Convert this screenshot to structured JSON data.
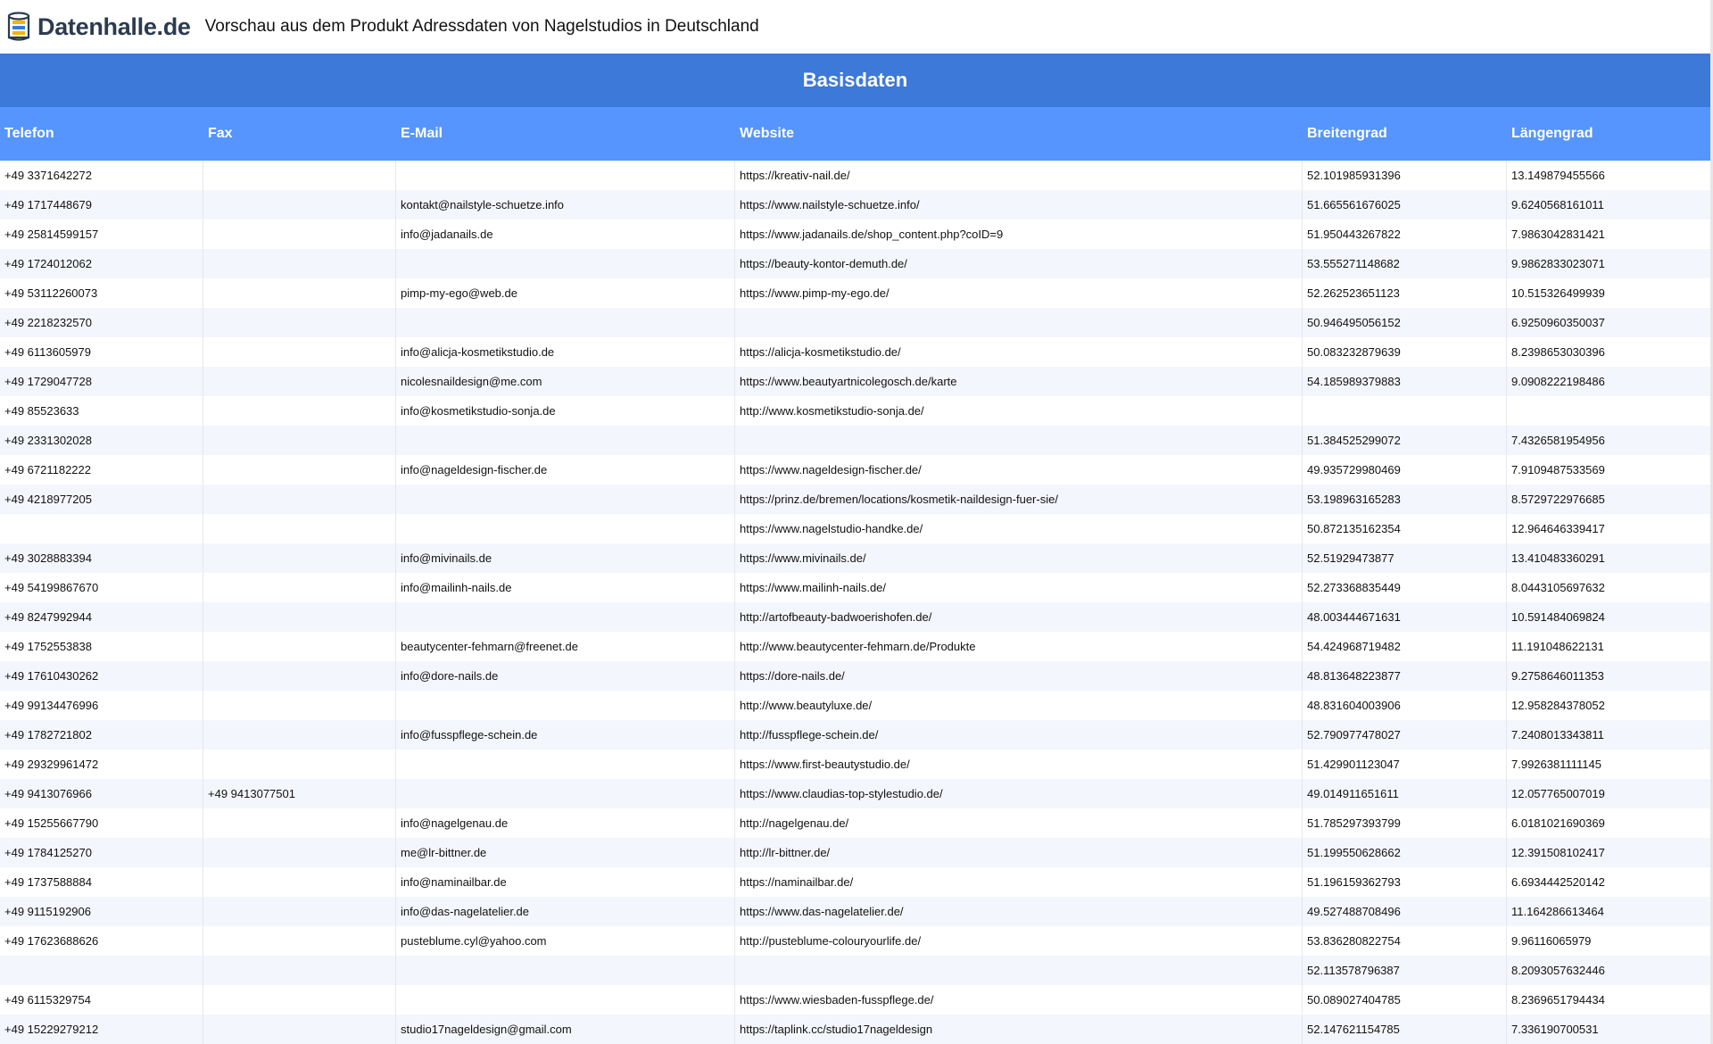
{
  "header": {
    "logo_text": "Datenhalle.de",
    "title": "Vorschau aus dem Produkt Adressdaten von Nagelstudios in Deutschland"
  },
  "section": {
    "title": "Basisdaten"
  },
  "columns": [
    "Telefon",
    "Fax",
    "E-Mail",
    "Website",
    "Breitengrad",
    "Längengrad"
  ],
  "rows": [
    [
      "+49 3371642272",
      "",
      "",
      "https://kreativ-nail.de/",
      "52.101985931396",
      "13.149879455566"
    ],
    [
      "+49 1717448679",
      "",
      "kontakt@nailstyle-schuetze.info",
      "https://www.nailstyle-schuetze.info/",
      "51.665561676025",
      "9.6240568161011"
    ],
    [
      "+49 25814599157",
      "",
      "info@jadanails.de",
      "https://www.jadanails.de/shop_content.php?coID=9",
      "51.950443267822",
      "7.9863042831421"
    ],
    [
      "+49 1724012062",
      "",
      "",
      "https://beauty-kontor-demuth.de/",
      "53.555271148682",
      "9.9862833023071"
    ],
    [
      "+49 53112260073",
      "",
      "pimp-my-ego@web.de",
      "https://www.pimp-my-ego.de/",
      "52.262523651123",
      "10.515326499939"
    ],
    [
      "+49 2218232570",
      "",
      "",
      "",
      "50.946495056152",
      "6.9250960350037"
    ],
    [
      "+49 6113605979",
      "",
      "info@alicja-kosmetikstudio.de",
      "https://alicja-kosmetikstudio.de/",
      "50.083232879639",
      "8.2398653030396"
    ],
    [
      "+49 1729047728",
      "",
      "nicolesnaildesign@me.com",
      "https://www.beautyartnicolegosch.de/karte",
      "54.185989379883",
      "9.0908222198486"
    ],
    [
      "+49 85523633",
      "",
      "info@kosmetikstudio-sonja.de",
      "http://www.kosmetikstudio-sonja.de/",
      "",
      ""
    ],
    [
      "+49 2331302028",
      "",
      "",
      "",
      "51.384525299072",
      "7.4326581954956"
    ],
    [
      "+49 6721182222",
      "",
      "info@nageldesign-fischer.de",
      "https://www.nageldesign-fischer.de/",
      "49.935729980469",
      "7.9109487533569"
    ],
    [
      "+49 4218977205",
      "",
      "",
      "https://prinz.de/bremen/locations/kosmetik-naildesign-fuer-sie/",
      "53.198963165283",
      "8.5729722976685"
    ],
    [
      "",
      "",
      "",
      "https://www.nagelstudio-handke.de/",
      "50.872135162354",
      "12.964646339417"
    ],
    [
      "+49 3028883394",
      "",
      "info@mivinails.de",
      "https://www.mivinails.de/",
      "52.51929473877",
      "13.410483360291"
    ],
    [
      "+49 54199867670",
      "",
      "info@mailinh-nails.de",
      "https://www.mailinh-nails.de/",
      "52.273368835449",
      "8.0443105697632"
    ],
    [
      "+49 8247992944",
      "",
      "",
      "http://artofbeauty-badwoerishofen.de/",
      "48.003444671631",
      "10.591484069824"
    ],
    [
      "+49 1752553838",
      "",
      "beautycenter-fehmarn@freenet.de",
      "http://www.beautycenter-fehmarn.de/Produkte",
      "54.424968719482",
      "11.191048622131"
    ],
    [
      "+49 17610430262",
      "",
      "info@dore-nails.de",
      "https://dore-nails.de/",
      "48.813648223877",
      "9.2758646011353"
    ],
    [
      "+49 99134476996",
      "",
      "",
      "http://www.beautyluxe.de/",
      "48.831604003906",
      "12.958284378052"
    ],
    [
      "+49 1782721802",
      "",
      "info@fusspflege-schein.de",
      "http://fusspflege-schein.de/",
      "52.790977478027",
      "7.2408013343811"
    ],
    [
      "+49 29329961472",
      "",
      "",
      "https://www.first-beautystudio.de/",
      "51.429901123047",
      "7.9926381111145"
    ],
    [
      "+49 9413076966",
      "+49 9413077501",
      "",
      "https://www.claudias-top-stylestudio.de/",
      "49.014911651611",
      "12.057765007019"
    ],
    [
      "+49 15255667790",
      "",
      "info@nagelgenau.de",
      "http://nagelgenau.de/",
      "51.785297393799",
      "6.0181021690369"
    ],
    [
      "+49 1784125270",
      "",
      "me@lr-bittner.de",
      "http://lr-bittner.de/",
      "51.199550628662",
      "12.391508102417"
    ],
    [
      "+49 1737588884",
      "",
      "info@naminailbar.de",
      "https://naminailbar.de/",
      "51.196159362793",
      "6.6934442520142"
    ],
    [
      "+49 9115192906",
      "",
      "info@das-nagelatelier.de",
      "https://www.das-nagelatelier.de/",
      "49.527488708496",
      "11.164286613464"
    ],
    [
      "+49 17623688626",
      "",
      "pusteblume.cyl@yahoo.com",
      "http://pusteblume-colouryourlife.de/",
      "53.836280822754",
      "9.96116065979"
    ],
    [
      "",
      "",
      "",
      "",
      "52.113578796387",
      "8.2093057632446"
    ],
    [
      "+49 6115329754",
      "",
      "",
      "https://www.wiesbaden-fusspflege.de/",
      "50.089027404785",
      "8.2369651794434"
    ],
    [
      "+49 15229279212",
      "",
      "studio17nageldesign@gmail.com",
      "https://taplink.cc/studio17nageldesign",
      "52.147621154785",
      "7.336190700531"
    ]
  ]
}
